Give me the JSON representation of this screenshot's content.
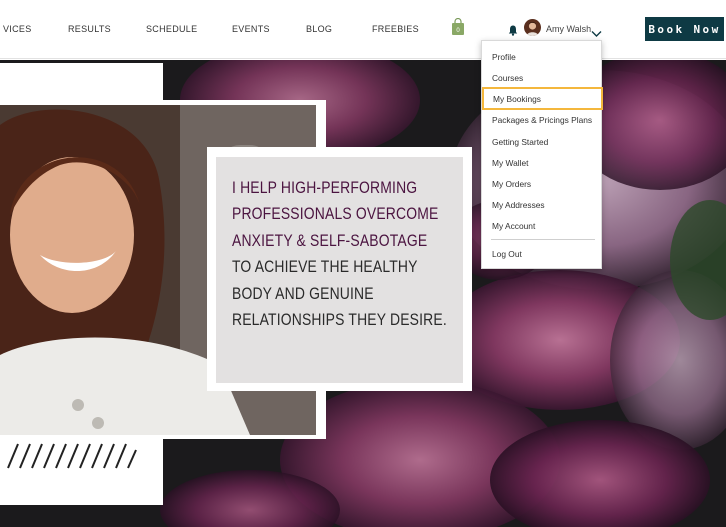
{
  "nav": {
    "items": [
      "VICES",
      "RESULTS",
      "SCHEDULE",
      "EVENTS",
      "BLOG",
      "FREEBIES"
    ],
    "cart_count": "0",
    "user_name": "Amy Walsh",
    "book_button": "Book Now"
  },
  "dropdown": {
    "items": [
      "Profile",
      "Courses",
      "My Bookings",
      "Packages & Pricings Plans",
      "Getting Started",
      "My Wallet",
      "My Orders",
      "My Addresses",
      "My Account"
    ],
    "logout": "Log Out",
    "highlighted": "My Bookings"
  },
  "hero": {
    "lines": [
      "I HELP HIGH-PERFORMING",
      "PROFESSIONALS OVERCOME",
      "ANXIETY & SELF-SABOTAGE",
      "TO ACHIEVE THE HEALTHY",
      "BODY AND GENUINE",
      "RELATIONSHIPS THEY DESIRE."
    ]
  },
  "colors": {
    "accent_text": "#4b1440",
    "book_button_bg": "#0e3a44",
    "highlight_outline": "#f4b73c",
    "cart_green": "#7a9a5a"
  }
}
